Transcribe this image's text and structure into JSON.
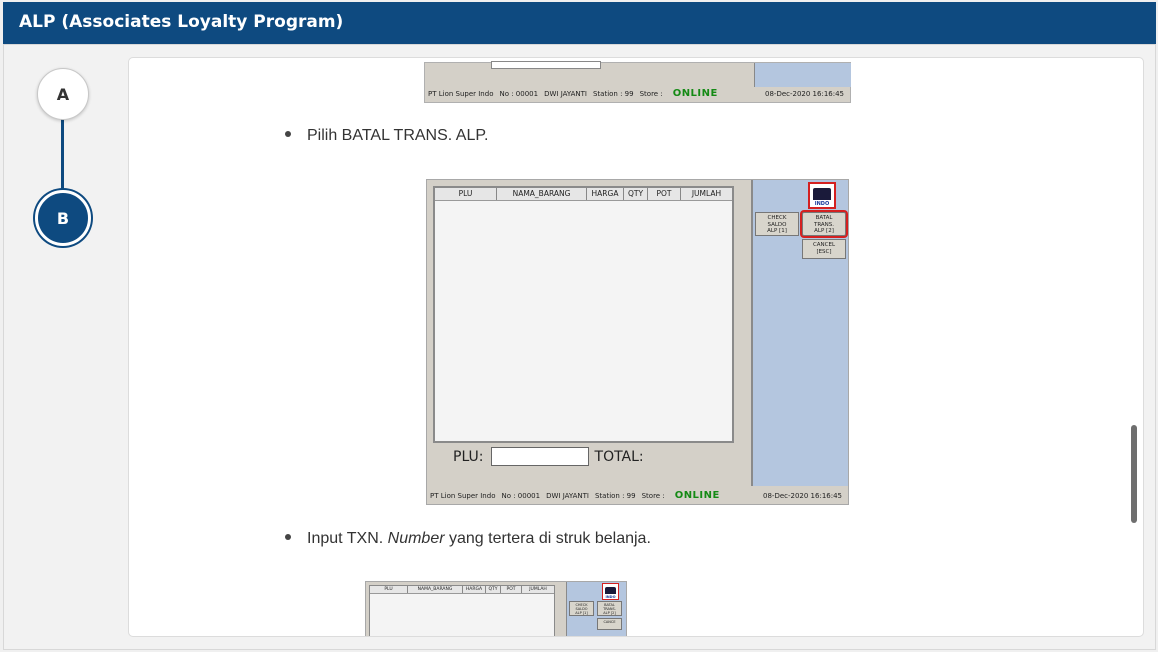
{
  "header": {
    "title": "ALP (Associates Loyalty Program)"
  },
  "steps": [
    {
      "label": "A",
      "active": false
    },
    {
      "label": "B",
      "active": true
    }
  ],
  "pos_status": {
    "company": "PT Lion Super Indo",
    "no": "No : 00001",
    "user": "DWI JAYANTI",
    "station": "Station : 99",
    "store": "Store :",
    "online": "ONLINE",
    "datetime": "08-Dec-2020 16:16:45"
  },
  "bullets": {
    "b1": "Pilih BATAL TRANS. ALP.",
    "b2_prefix": "Input TXN. ",
    "b2_italic": "Number",
    "b2_suffix": " yang tertera di struk belanja."
  },
  "pos_grid": {
    "columns": [
      "PLU",
      "NAMA_BARANG",
      "HARGA",
      "QTY",
      "POT",
      "JUMLAH"
    ]
  },
  "pos_labels": {
    "plu": "PLU:",
    "total": "TOTAL:"
  },
  "pos_logo": {
    "text": "INDO"
  },
  "pos_buttons": {
    "check_saldo": "CHECK\nSALDO\nALP [1]",
    "batal_trans": "BATAL\nTRANS.\nALP [2]",
    "cancel": "CANCEL\n[ESC]",
    "batal_trans_small": "BATAL\nTRANS.\nALP [2]",
    "check_saldo_small": "CHECK\nSALDO\nALP [1]",
    "cancel_small": "CANCE"
  },
  "colors": {
    "header_bg": "#0e4a80",
    "online": "#158a15",
    "pos_side": "#b4c6df",
    "highlight": "#d42020"
  }
}
